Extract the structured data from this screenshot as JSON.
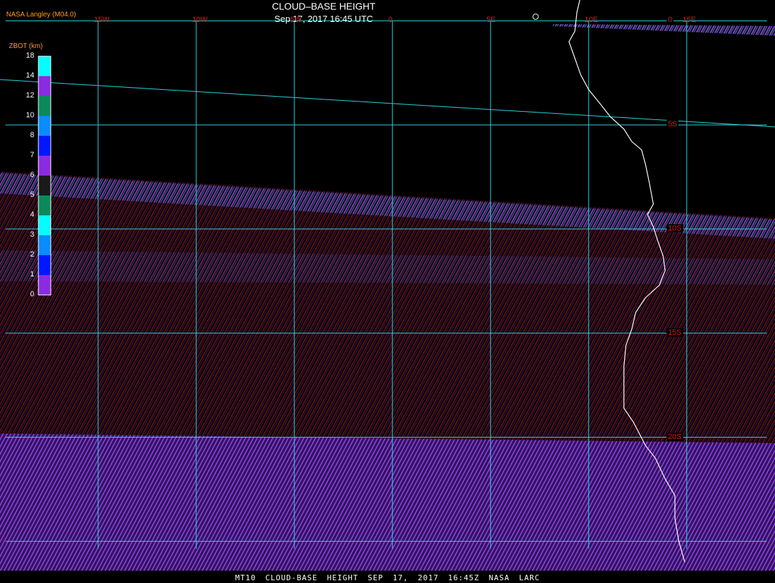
{
  "header": {
    "producer": "NASA Langley (M04.0)",
    "title": "CLOUD–BASE HEIGHT",
    "subtitle": "Sep 17, 2017 16:45 UTC"
  },
  "footer": {
    "text": "MT10  CLOUD-BASE HEIGHT  SEP 17, 2017 16:45Z  NASA LARC"
  },
  "colorbar": {
    "title": "ZBOT (km)",
    "ticks": [
      "18",
      "14",
      "12",
      "10",
      "8",
      "7",
      "6",
      "5",
      "4",
      "3",
      "2",
      "1",
      "0"
    ],
    "colors": [
      "#00ffff",
      "#8a2be2",
      "#0a8a5a",
      "#0a8cff",
      "#0018ff",
      "#8a2be2",
      "#1a1a1a",
      "#0a8a5a",
      "#00ffff",
      "#0a8cff",
      "#0018ff",
      "#8a2be2"
    ]
  },
  "map": {
    "lon_range": [
      -20,
      19.5
    ],
    "lat_range": [
      1,
      -27
    ],
    "gridline_color": "#26d6e0",
    "coastline_color": "#ffffff",
    "longitude_labels": [
      {
        "value": -15,
        "label": "15W"
      },
      {
        "value": -10,
        "label": "10W"
      },
      {
        "value": -5,
        "label": "5W"
      },
      {
        "value": 0,
        "label": "0"
      },
      {
        "value": 5,
        "label": "5E"
      },
      {
        "value": 10,
        "label": "10E"
      },
      {
        "value": 15,
        "label": "15E"
      }
    ],
    "latitude_labels": [
      {
        "value": 0,
        "label": "0"
      },
      {
        "value": -5,
        "label": "5S"
      },
      {
        "value": -10,
        "label": "10S"
      },
      {
        "value": -15,
        "label": "15S"
      },
      {
        "value": -20,
        "label": "20S"
      }
    ],
    "coastline": [
      [
        9.6,
        1.2
      ],
      [
        9.4,
        0.4
      ],
      [
        9.3,
        -0.5
      ],
      [
        9.0,
        -1.0
      ],
      [
        9.3,
        -1.8
      ],
      [
        9.6,
        -2.6
      ],
      [
        10.0,
        -3.3
      ],
      [
        10.6,
        -4.0
      ],
      [
        11.1,
        -4.6
      ],
      [
        11.8,
        -5.2
      ],
      [
        12.2,
        -5.8
      ],
      [
        12.7,
        -6.2
      ],
      [
        12.9,
        -6.9
      ],
      [
        13.1,
        -7.8
      ],
      [
        13.3,
        -8.8
      ],
      [
        13.0,
        -9.3
      ],
      [
        13.3,
        -9.9
      ],
      [
        13.5,
        -10.5
      ],
      [
        13.8,
        -11.3
      ],
      [
        13.9,
        -12.0
      ],
      [
        13.6,
        -12.7
      ],
      [
        12.9,
        -13.3
      ],
      [
        12.4,
        -14.0
      ],
      [
        12.2,
        -14.8
      ],
      [
        11.9,
        -15.6
      ],
      [
        11.8,
        -16.6
      ],
      [
        11.8,
        -17.5
      ],
      [
        11.8,
        -18.6
      ],
      [
        12.3,
        -19.3
      ],
      [
        12.9,
        -20.4
      ],
      [
        13.4,
        -21.0
      ],
      [
        13.9,
        -22.0
      ],
      [
        14.4,
        -22.8
      ],
      [
        14.4,
        -23.9
      ],
      [
        14.6,
        -25.0
      ],
      [
        14.9,
        -26.0
      ]
    ],
    "island_label": ""
  },
  "chart_data": {
    "type": "heatmap",
    "title": "CLOUD–BASE HEIGHT",
    "variable": "ZBOT (km)",
    "value_range": [
      0,
      18
    ],
    "colorscale_ticks": [
      18,
      14,
      12,
      10,
      8,
      7,
      6,
      5,
      4,
      3,
      2,
      1,
      0
    ],
    "regions": [
      {
        "lat": [
          1,
          0
        ],
        "coverage": "scan-edge stripes",
        "zbot_km": [
          2,
          3
        ]
      },
      {
        "lat": [
          0,
          -5.5
        ],
        "coverage": "clear",
        "zbot_km": null
      },
      {
        "lat": [
          -5.5,
          -11
        ],
        "coverage": "broken low cloud",
        "zbot_km": [
          0,
          3
        ]
      },
      {
        "lat": [
          -11,
          -20
        ],
        "coverage": "overcast low cloud",
        "zbot_km": [
          0,
          1
        ]
      },
      {
        "lat": [
          -20,
          -27
        ],
        "coverage": "overcast low cloud",
        "zbot_km": [
          0,
          2
        ]
      }
    ]
  }
}
